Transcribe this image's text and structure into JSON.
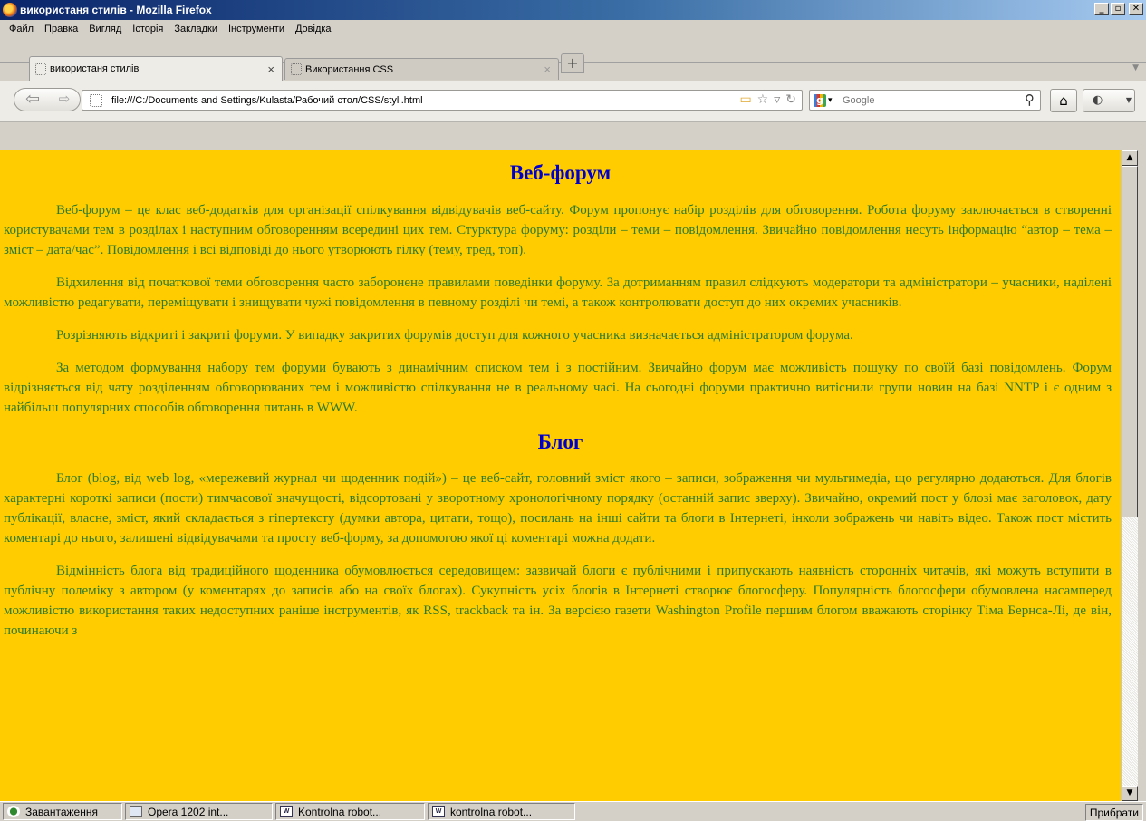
{
  "window": {
    "title": "використаня стилів - Mozilla Firefox",
    "btn_min": "_",
    "btn_max": "▫",
    "btn_close": "✕"
  },
  "menu": [
    "Файл",
    "Правка",
    "Вигляд",
    "Історія",
    "Закладки",
    "Інструменти",
    "Довідка"
  ],
  "tabs": [
    {
      "label": "використаня стилів",
      "active": true,
      "close": "×"
    },
    {
      "label": "Використання CSS",
      "active": false,
      "close": "×"
    }
  ],
  "new_tab_label": "+",
  "nav": {
    "back": "⇦",
    "forward": "⇨",
    "url": "file:///C:/Documents and Settings/Kulasta/Рабочий стол/CSS/styli.html",
    "search_placeholder": "Google",
    "search_engine_letter": "g",
    "search_engine_dropdown": "▾",
    "home": "⌂",
    "addon": "◐"
  },
  "content": {
    "heading1": "Веб-форум",
    "section1": [
      "Веб-форум – це клас веб-додатків для організації спілкування відвідувачів веб-сайту. Форум пропонує набір розділів для обговорення. Робота форуму заключається в створенні користувачами тем в розділах і наступним обговоренням всередині цих тем. Стурктура форуму: розділи – теми – повідомлення. Звичайно повідомлення несуть інформацію “автор – тема – зміст – дата/час”. Повідомлення і всі відповіді до нього утворюють гілку (тему, тред, топ).",
      "Відхилення від початкової теми обговорення часто заборонене правилами поведінки форуму. За дотриманням правил слідкують модератори та адміністратори – учасники, наділені можливістю редагувати, переміщувати і знищувати чужі повідомлення в певному розділі чи темі, а також контролювати доступ до них окремих учасників.",
      "Розрізняють відкриті і закриті форуми. У випадку закритих форумів доступ для кожного учасника визначається адміністратором форума.",
      "За методом формування набору тем форуми бувають з динамічним списком тем і з постійним. Звичайно форум має можливість пошуку по своїй базі повідомлень. Форум відрізняється від чату розділенням обговорюваних тем і можливістю спілкування не в реальному часі. На сьогодні форуми практично витіснили групи новин на базі NNTP і є одним з найбільш популярних способів обговорення питань в WWW."
    ],
    "heading2": "Блог",
    "section2": [
      "Блог (blog, від web log, «мережевий журнал чи щоденник подій») – це веб-сайт, головний зміст якого – записи, зображення чи мультимедіа, що регулярно додаються. Для блогів характерні короткі записи (пости) тимчасової значущості, відсортовані у зворотному хронологічному порядку (останній запис зверху). Звичайно, окремий пост у блозі має заголовок, дату публікації, власне, зміст, який складається з гіпертексту (думки автора, цитати, тощо), посилань на інші сайти та блоги в Інтернеті, інколи зображень чи навіть відео. Також пост містить коментарі до нього, залишені відвідувачами та просту веб-форму, за допомогою якої ці коментарі можна додати.",
      "Відмінність блога від традиційного щоденника обумовлюється середовищем: зазвичай блоги є публічними і припускають наявність сторонніх читачів, які можуть вступити в публічну полеміку з автором (у коментарях до записів або на своїх блогах). Сукупність усіх блогів в Інтернеті створює блогосферу. Популярність блогосфери обумовлена насамперед можливістю використання таких недоступних раніше інструментів, як RSS, trackback та ін. За версією газети Washington Profile першим блогом вважають сторінку Тіма Бернса-Лі, де він, починаючи з"
    ]
  },
  "statusbar": {
    "loading": "Завантаження",
    "tasks": [
      "Opera 1202 int...",
      "Kontrolna robot...",
      "kontrolna robot..."
    ],
    "right": "Прибрати"
  },
  "colors": {
    "page_bg": "#ffcc00",
    "heading": "#0000cc",
    "text": "#2e7a2a"
  }
}
